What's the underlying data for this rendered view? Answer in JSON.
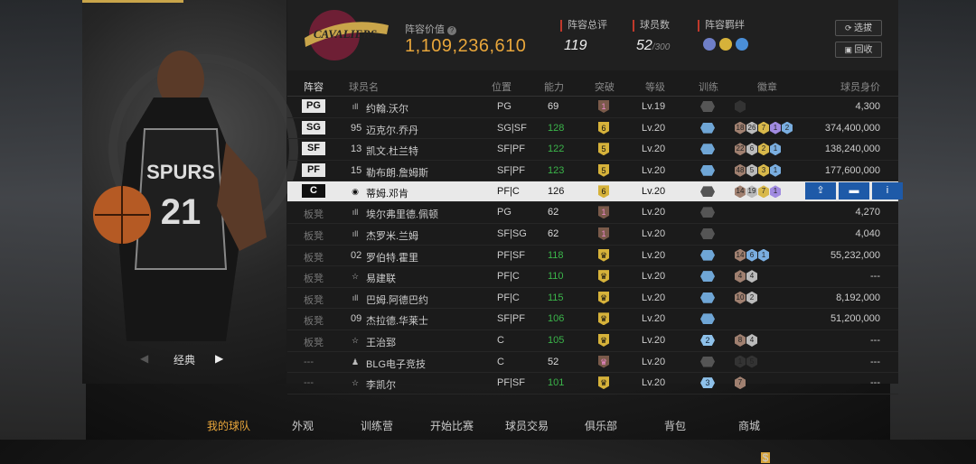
{
  "header": {
    "value_label": "阵容价值",
    "value": "1,109,236,610",
    "team_name": "CAVALIERS",
    "rating_label": "阵容总评",
    "rating": "119",
    "count_label": "球员数",
    "count": "52",
    "count_max": "/300",
    "bond_label": "阵容羁绊",
    "btn_filter": "选拔",
    "btn_recycle": "回收"
  },
  "left": {
    "mode": "经典",
    "jersey_team": "SPURS",
    "jersey_number": "21"
  },
  "columns": [
    "阵容",
    "球员名",
    "位置",
    "能力",
    "突破",
    "等级",
    "训练",
    "徽章",
    "球员身价"
  ],
  "rows": [
    {
      "slot": "PG",
      "bench": false,
      "num": "",
      "icon": "bars",
      "name": "约翰.沃尔",
      "pos": "PG",
      "ability": "69",
      "ability_color": "#ddd",
      "break": "1",
      "break_gold": false,
      "level": "Lv.19",
      "train": "grey",
      "train_num": "",
      "badges": [
        [
          "b0",
          ""
        ]
      ],
      "price": "4,300"
    },
    {
      "slot": "SG",
      "bench": false,
      "num": "95",
      "icon": "",
      "name": "迈克尔.乔丹",
      "pos": "SG|SF",
      "ability": "128",
      "ability_color": "#3bb54a",
      "break": "6",
      "break_gold": true,
      "level": "Lv.20",
      "train": "blue",
      "train_num": "",
      "badges": [
        [
          "b1",
          "18"
        ],
        [
          "b2",
          "26"
        ],
        [
          "b3",
          "7"
        ],
        [
          "b4",
          "1"
        ],
        [
          "b5",
          "2"
        ]
      ],
      "price": "374,400,000"
    },
    {
      "slot": "SF",
      "bench": false,
      "num": "13",
      "icon": "",
      "name": "凯文.杜兰特",
      "pos": "SF|PF",
      "ability": "122",
      "ability_color": "#3bb54a",
      "break": "5",
      "break_gold": true,
      "level": "Lv.20",
      "train": "blue",
      "train_num": "",
      "badges": [
        [
          "b1",
          "22"
        ],
        [
          "b2",
          "6"
        ],
        [
          "b3",
          "2"
        ],
        [
          "b5",
          "1"
        ]
      ],
      "price": "138,240,000"
    },
    {
      "slot": "PF",
      "bench": false,
      "num": "15",
      "icon": "",
      "name": "勒布朗.詹姆斯",
      "pos": "SF|PF",
      "ability": "123",
      "ability_color": "#3bb54a",
      "break": "5",
      "break_gold": true,
      "level": "Lv.20",
      "train": "blue",
      "train_num": "",
      "badges": [
        [
          "b1",
          "48"
        ],
        [
          "b2",
          "5"
        ],
        [
          "b3",
          "3"
        ],
        [
          "b5",
          "1"
        ]
      ],
      "price": "177,600,000"
    },
    {
      "slot": "C",
      "bench": false,
      "sel": true,
      "num": "",
      "icon": "circle",
      "name": "蒂姆.邓肯",
      "pos": "PF|C",
      "ability": "126",
      "ability_color": "#111",
      "break": "6",
      "break_gold": true,
      "level": "Lv.20",
      "train": "grey",
      "train_num": "",
      "badges": [
        [
          "b1",
          "14"
        ],
        [
          "b2",
          "19"
        ],
        [
          "b3",
          "7"
        ],
        [
          "b4",
          "1"
        ]
      ],
      "price": ""
    },
    {
      "slot": "板凳",
      "bench": true,
      "num": "",
      "icon": "bars",
      "name": "埃尔弗里德.佩顿",
      "pos": "PG",
      "ability": "62",
      "ability_color": "#ddd",
      "break": "1",
      "break_gold": false,
      "level": "Lv.20",
      "train": "grey",
      "train_num": "",
      "badges": [],
      "price": "4,270"
    },
    {
      "slot": "板凳",
      "bench": true,
      "num": "",
      "icon": "bars",
      "name": "杰罗米.兰姆",
      "pos": "SF|SG",
      "ability": "62",
      "ability_color": "#ddd",
      "break": "1",
      "break_gold": false,
      "level": "Lv.20",
      "train": "grey",
      "train_num": "",
      "badges": [],
      "price": "4,040"
    },
    {
      "slot": "板凳",
      "bench": true,
      "num": "02",
      "icon": "",
      "name": "罗伯特.霍里",
      "pos": "PF|SF",
      "ability": "118",
      "ability_color": "#3bb54a",
      "break": "♛",
      "break_gold": true,
      "level": "Lv.20",
      "train": "blue",
      "train_num": "",
      "badges": [
        [
          "b1",
          "14"
        ],
        [
          "b5",
          "6"
        ],
        [
          "b5",
          "1"
        ]
      ],
      "price": "55,232,000"
    },
    {
      "slot": "板凳",
      "bench": true,
      "num": "",
      "icon": "star",
      "name": "易建联",
      "pos": "PF|C",
      "ability": "110",
      "ability_color": "#3bb54a",
      "break": "♛",
      "break_gold": true,
      "level": "Lv.20",
      "train": "blue",
      "train_num": "",
      "badges": [
        [
          "b1",
          "4"
        ],
        [
          "b2",
          "4"
        ]
      ],
      "price": "---"
    },
    {
      "slot": "板凳",
      "bench": true,
      "num": "",
      "icon": "bars",
      "name": "巴姆.阿德巴约",
      "pos": "PF|C",
      "ability": "115",
      "ability_color": "#3bb54a",
      "break": "♛",
      "break_gold": true,
      "level": "Lv.20",
      "train": "blue",
      "train_num": "",
      "badges": [
        [
          "b1",
          "10"
        ],
        [
          "b2",
          "2"
        ]
      ],
      "price": "8,192,000"
    },
    {
      "slot": "板凳",
      "bench": true,
      "num": "09",
      "icon": "",
      "name": "杰拉德.华莱士",
      "pos": "SF|PF",
      "ability": "106",
      "ability_color": "#3bb54a",
      "break": "♛",
      "break_gold": true,
      "level": "Lv.20",
      "train": "blue",
      "train_num": "",
      "badges": [],
      "price": "51,200,000"
    },
    {
      "slot": "板凳",
      "bench": true,
      "num": "",
      "icon": "star",
      "name": "王治郅",
      "pos": "C",
      "ability": "105",
      "ability_color": "#3bb54a",
      "break": "♛",
      "break_gold": true,
      "level": "Lv.20",
      "train": "num",
      "train_num": "2",
      "badges": [
        [
          "b1",
          "8"
        ],
        [
          "b2",
          "4"
        ]
      ],
      "price": "---"
    },
    {
      "slot": "---",
      "bench": true,
      "num": "",
      "icon": "person",
      "name": "BLG电子竞技",
      "pos": "C",
      "ability": "52",
      "ability_color": "#ddd",
      "break": "♛",
      "break_gold": false,
      "level": "Lv.20",
      "train": "grey",
      "train_num": "",
      "badges": [
        [
          "b0",
          "1"
        ],
        [
          "b0",
          "5"
        ]
      ],
      "price": "---"
    },
    {
      "slot": "---",
      "bench": true,
      "num": "",
      "icon": "star",
      "name": "李凯尔",
      "pos": "PF|SF",
      "ability": "101",
      "ability_color": "#3bb54a",
      "break": "♛",
      "break_gold": true,
      "level": "Lv.20",
      "train": "num",
      "train_num": "3",
      "badges": [
        [
          "b1",
          "7"
        ]
      ],
      "price": "---"
    }
  ],
  "nav": [
    {
      "label": "我的球队",
      "active": true
    },
    {
      "label": "外观",
      "active": false
    },
    {
      "label": "训练营",
      "active": false
    },
    {
      "label": "开始比赛",
      "active": false
    },
    {
      "label": "球员交易",
      "active": false
    },
    {
      "label": "俱乐部",
      "active": false
    },
    {
      "label": "背包",
      "active": false
    },
    {
      "label": "商城",
      "active": false
    }
  ],
  "shop_badge": "$",
  "colors": {
    "accent": "#e8a63b",
    "green": "#3bb54a",
    "action_blue": "#1e5aa8"
  }
}
